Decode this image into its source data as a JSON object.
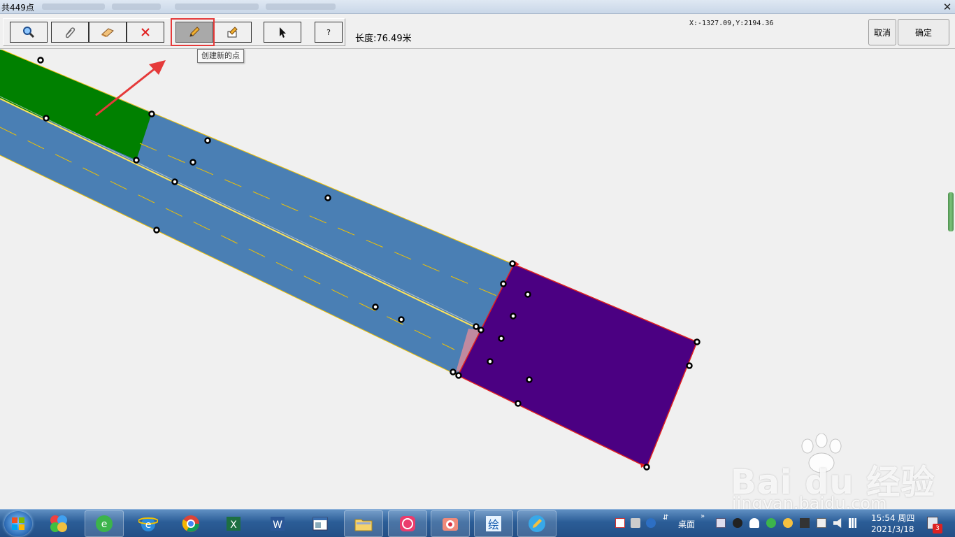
{
  "window": {
    "title": "共449点"
  },
  "toolbar": {
    "tool_buttons": [
      {
        "name": "zoom-tool",
        "icon": "magnifier-icon"
      },
      {
        "name": "measure-tool",
        "icon": "paperclip-icon"
      },
      {
        "name": "eraser-tool",
        "icon": "eraser-icon"
      },
      {
        "name": "delete-tool",
        "icon": "red-x-icon"
      },
      {
        "name": "create-point-tool",
        "icon": "pencil-icon",
        "active": true
      },
      {
        "name": "edit-tool",
        "icon": "edit-shape-icon"
      },
      {
        "name": "select-tool",
        "icon": "arrow-cursor-icon"
      },
      {
        "name": "help-tool",
        "label": "?"
      }
    ],
    "length_text": "长度:76.49米",
    "coords_text": "X:-1327.09,Y:2194.36",
    "cancel_label": "取消",
    "confirm_label": "确定"
  },
  "tooltip": {
    "text": "创建新的点"
  },
  "watermark": {
    "brand": "Bai du 经验",
    "url": "jingyan.baidu.com"
  },
  "colors": {
    "road": "#4a7fb4",
    "green_area": "#008000",
    "purple_area": "#4b0082",
    "lane_line": "#f2c200",
    "highlight": "#e53a3a"
  },
  "taskbar": {
    "apps": [
      "photos",
      "ie-360",
      "internet-explorer",
      "chrome",
      "excel",
      "word",
      "window-app",
      "file-explorer",
      "meitu",
      "camera-app",
      "paint-app",
      "pencil-app"
    ],
    "tray": {
      "desktop_label": "桌面",
      "time": "15:54 周四",
      "date": "2021/3/18",
      "badge": "3"
    }
  }
}
